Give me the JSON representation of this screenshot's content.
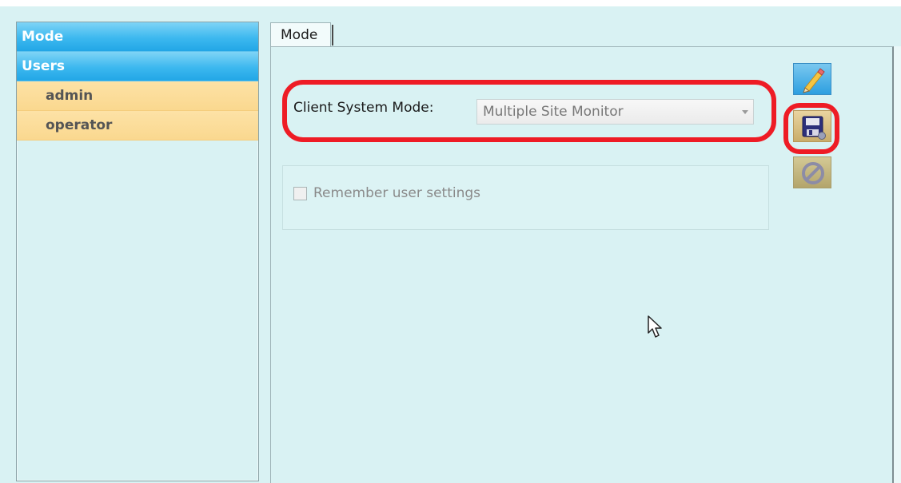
{
  "sidebar": {
    "groups": [
      {
        "label": "Mode"
      },
      {
        "label": "Users",
        "items": [
          {
            "label": "admin"
          },
          {
            "label": "operator"
          }
        ]
      }
    ]
  },
  "tabs": [
    {
      "label": "Mode"
    }
  ],
  "mode_form": {
    "client_system_mode_label": "Client System Mode:",
    "client_system_mode_value": "Multiple Site Monitor",
    "remember_settings_label": "Remember user settings",
    "remember_settings_checked": false
  },
  "toolbar": {
    "edit_icon": "pencil-icon",
    "save_icon": "floppy-disk-icon",
    "cancel_icon": "cancel-icon"
  },
  "colors": {
    "background": "#d9f2f3",
    "group_header": "#3cb8ef",
    "tree_item": "#fbdc97",
    "highlight": "#ee1c25"
  }
}
